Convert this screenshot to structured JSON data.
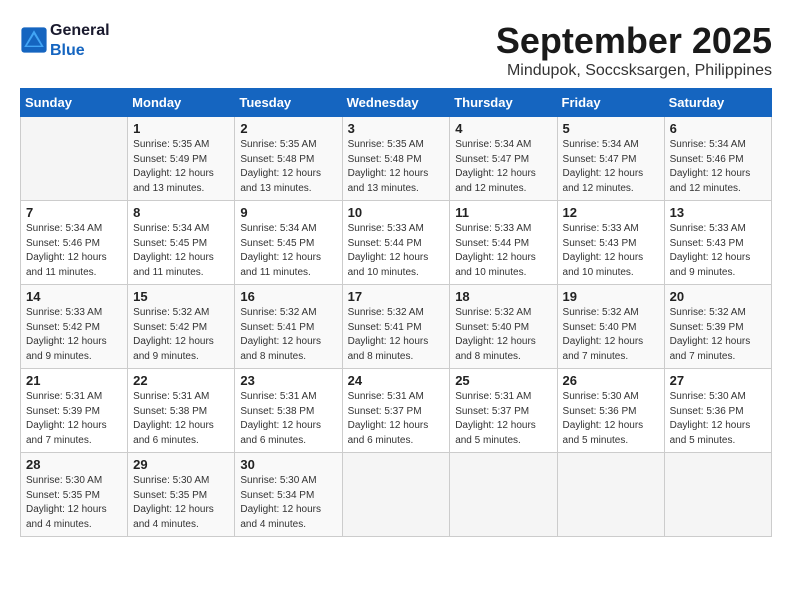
{
  "header": {
    "logo_general": "General",
    "logo_blue": "Blue",
    "month": "September 2025",
    "location": "Mindupok, Soccsksargen, Philippines"
  },
  "days_of_week": [
    "Sunday",
    "Monday",
    "Tuesday",
    "Wednesday",
    "Thursday",
    "Friday",
    "Saturday"
  ],
  "weeks": [
    [
      {
        "day": "",
        "info": ""
      },
      {
        "day": "1",
        "info": "Sunrise: 5:35 AM\nSunset: 5:49 PM\nDaylight: 12 hours\nand 13 minutes."
      },
      {
        "day": "2",
        "info": "Sunrise: 5:35 AM\nSunset: 5:48 PM\nDaylight: 12 hours\nand 13 minutes."
      },
      {
        "day": "3",
        "info": "Sunrise: 5:35 AM\nSunset: 5:48 PM\nDaylight: 12 hours\nand 13 minutes."
      },
      {
        "day": "4",
        "info": "Sunrise: 5:34 AM\nSunset: 5:47 PM\nDaylight: 12 hours\nand 12 minutes."
      },
      {
        "day": "5",
        "info": "Sunrise: 5:34 AM\nSunset: 5:47 PM\nDaylight: 12 hours\nand 12 minutes."
      },
      {
        "day": "6",
        "info": "Sunrise: 5:34 AM\nSunset: 5:46 PM\nDaylight: 12 hours\nand 12 minutes."
      }
    ],
    [
      {
        "day": "7",
        "info": "Sunrise: 5:34 AM\nSunset: 5:46 PM\nDaylight: 12 hours\nand 11 minutes."
      },
      {
        "day": "8",
        "info": "Sunrise: 5:34 AM\nSunset: 5:45 PM\nDaylight: 12 hours\nand 11 minutes."
      },
      {
        "day": "9",
        "info": "Sunrise: 5:34 AM\nSunset: 5:45 PM\nDaylight: 12 hours\nand 11 minutes."
      },
      {
        "day": "10",
        "info": "Sunrise: 5:33 AM\nSunset: 5:44 PM\nDaylight: 12 hours\nand 10 minutes."
      },
      {
        "day": "11",
        "info": "Sunrise: 5:33 AM\nSunset: 5:44 PM\nDaylight: 12 hours\nand 10 minutes."
      },
      {
        "day": "12",
        "info": "Sunrise: 5:33 AM\nSunset: 5:43 PM\nDaylight: 12 hours\nand 10 minutes."
      },
      {
        "day": "13",
        "info": "Sunrise: 5:33 AM\nSunset: 5:43 PM\nDaylight: 12 hours\nand 9 minutes."
      }
    ],
    [
      {
        "day": "14",
        "info": "Sunrise: 5:33 AM\nSunset: 5:42 PM\nDaylight: 12 hours\nand 9 minutes."
      },
      {
        "day": "15",
        "info": "Sunrise: 5:32 AM\nSunset: 5:42 PM\nDaylight: 12 hours\nand 9 minutes."
      },
      {
        "day": "16",
        "info": "Sunrise: 5:32 AM\nSunset: 5:41 PM\nDaylight: 12 hours\nand 8 minutes."
      },
      {
        "day": "17",
        "info": "Sunrise: 5:32 AM\nSunset: 5:41 PM\nDaylight: 12 hours\nand 8 minutes."
      },
      {
        "day": "18",
        "info": "Sunrise: 5:32 AM\nSunset: 5:40 PM\nDaylight: 12 hours\nand 8 minutes."
      },
      {
        "day": "19",
        "info": "Sunrise: 5:32 AM\nSunset: 5:40 PM\nDaylight: 12 hours\nand 7 minutes."
      },
      {
        "day": "20",
        "info": "Sunrise: 5:32 AM\nSunset: 5:39 PM\nDaylight: 12 hours\nand 7 minutes."
      }
    ],
    [
      {
        "day": "21",
        "info": "Sunrise: 5:31 AM\nSunset: 5:39 PM\nDaylight: 12 hours\nand 7 minutes."
      },
      {
        "day": "22",
        "info": "Sunrise: 5:31 AM\nSunset: 5:38 PM\nDaylight: 12 hours\nand 6 minutes."
      },
      {
        "day": "23",
        "info": "Sunrise: 5:31 AM\nSunset: 5:38 PM\nDaylight: 12 hours\nand 6 minutes."
      },
      {
        "day": "24",
        "info": "Sunrise: 5:31 AM\nSunset: 5:37 PM\nDaylight: 12 hours\nand 6 minutes."
      },
      {
        "day": "25",
        "info": "Sunrise: 5:31 AM\nSunset: 5:37 PM\nDaylight: 12 hours\nand 5 minutes."
      },
      {
        "day": "26",
        "info": "Sunrise: 5:30 AM\nSunset: 5:36 PM\nDaylight: 12 hours\nand 5 minutes."
      },
      {
        "day": "27",
        "info": "Sunrise: 5:30 AM\nSunset: 5:36 PM\nDaylight: 12 hours\nand 5 minutes."
      }
    ],
    [
      {
        "day": "28",
        "info": "Sunrise: 5:30 AM\nSunset: 5:35 PM\nDaylight: 12 hours\nand 4 minutes."
      },
      {
        "day": "29",
        "info": "Sunrise: 5:30 AM\nSunset: 5:35 PM\nDaylight: 12 hours\nand 4 minutes."
      },
      {
        "day": "30",
        "info": "Sunrise: 5:30 AM\nSunset: 5:34 PM\nDaylight: 12 hours\nand 4 minutes."
      },
      {
        "day": "",
        "info": ""
      },
      {
        "day": "",
        "info": ""
      },
      {
        "day": "",
        "info": ""
      },
      {
        "day": "",
        "info": ""
      }
    ]
  ]
}
